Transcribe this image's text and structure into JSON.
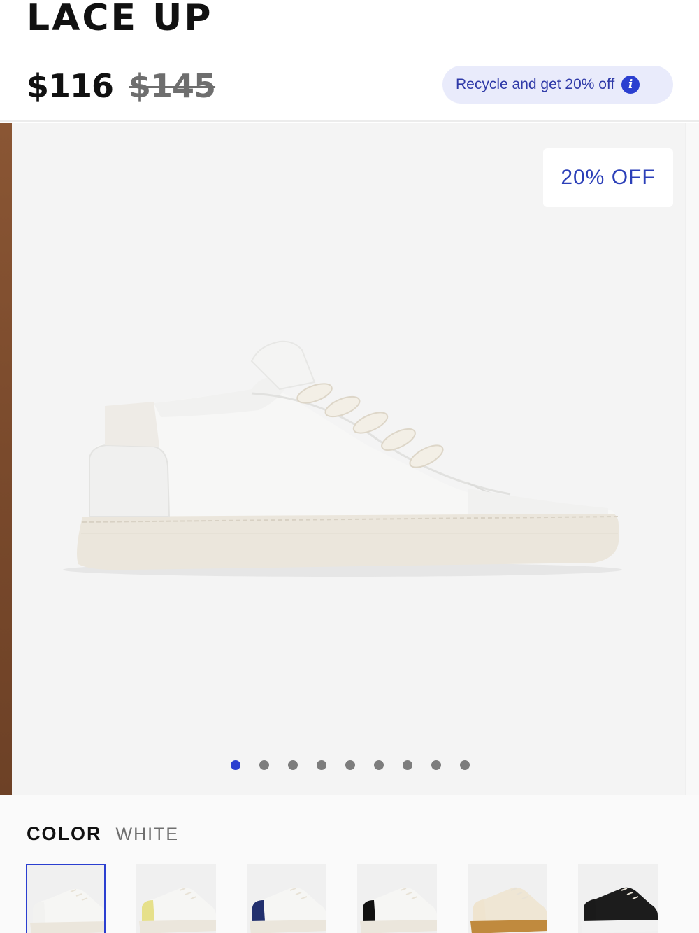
{
  "product": {
    "title": "LACE UP",
    "price_current": "$116",
    "price_original": "$145"
  },
  "promo": {
    "recycle_label": "Recycle and get 20% off",
    "info_icon": "info-icon"
  },
  "gallery": {
    "badge": "20% OFF",
    "image_alt": "White lace-up sneaker",
    "total_images": 9,
    "active_index": 0
  },
  "color": {
    "label": "COLOR",
    "selected": "WHITE",
    "swatches": [
      {
        "name": "white",
        "accent": "#f2f2f0",
        "sole": "#ebe6dc",
        "upper": "#f6f6f4"
      },
      {
        "name": "white-yellow",
        "accent": "#e6e08a",
        "sole": "#ebe6dc",
        "upper": "#f6f6f4"
      },
      {
        "name": "white-navy",
        "accent": "#22306e",
        "sole": "#ebe6dc",
        "upper": "#f6f6f4"
      },
      {
        "name": "white-black",
        "accent": "#111111",
        "sole": "#ebe6dc",
        "upper": "#f6f6f4"
      },
      {
        "name": "cream-gum",
        "accent": "#efe4cf",
        "sole": "#c08a3e",
        "upper": "#efe6d4"
      },
      {
        "name": "black",
        "accent": "#1a1a1a",
        "sole": "#f2f2f2",
        "upper": "#1c1c1c"
      }
    ]
  },
  "colors": {
    "accent_blue": "#2b3fd0",
    "pill_bg": "#e9ebfb",
    "badge_text": "#2b3fb8"
  }
}
